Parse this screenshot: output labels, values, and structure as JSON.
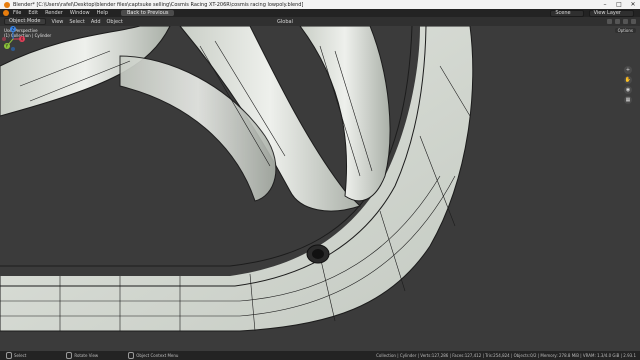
{
  "window": {
    "title": "Blender* [C:\\Users\\rafel\\Desktop\\blender files\\captsuke selling\\Cosmis Racing XT-206R\\cosmis racing lowpoly.blend]",
    "controls": [
      "–",
      "□",
      "✕"
    ]
  },
  "menubar": {
    "items": [
      "File",
      "Edit",
      "Render",
      "Window",
      "Help"
    ],
    "workspace_tab": "Back to Previous",
    "scene_label": "Scene",
    "view_layer_label": "View Layer"
  },
  "tool_header": {
    "mode": "Object Mode",
    "menus": [
      "View",
      "Select",
      "Add",
      "Object"
    ],
    "orientation": "Global"
  },
  "viewport": {
    "info_line1": "User Perspective",
    "info_line2": "(1) Collection | Cylinder",
    "options_label": "Options",
    "gizmo_axes": [
      "X",
      "Y",
      "Z"
    ]
  },
  "statusbar": {
    "select": "Select",
    "rotate": "Rotate View",
    "context_menu": "Object Context Menu",
    "stats": "Collection | Cylinder | Verts:127,286 | Faces:127,412 | Tris:254,824 | Objects:0/2 | Memory: 278.8 MiB | VRAM: 1.3/4.0 GiB | 2.93.1"
  },
  "colors": {
    "accent": "#e87d0d",
    "viewport_bg": "#3a3a3a",
    "header_bg": "#303030",
    "wire": "#1c1c1c",
    "surface": "#d7dcd5",
    "x_axis": "#e8405a",
    "y_axis": "#8cc43a",
    "z_axis": "#3a86e8"
  }
}
